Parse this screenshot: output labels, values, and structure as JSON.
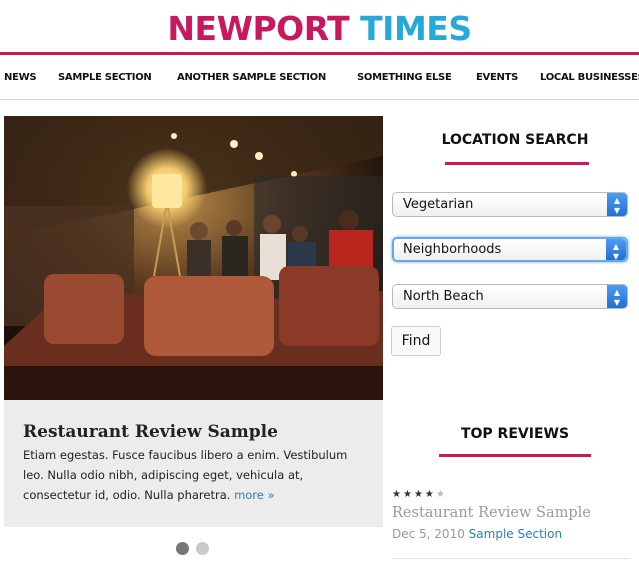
{
  "masthead": {
    "title_part1": "NEWPORT",
    "title_part2": "TIMES"
  },
  "nav": {
    "items": [
      {
        "label": "NEWS"
      },
      {
        "label": "SAMPLE SECTION"
      },
      {
        "label": "ANOTHER SAMPLE SECTION"
      },
      {
        "label": "SOMETHING ELSE"
      },
      {
        "label": "EVENTS"
      },
      {
        "label": "LOCAL BUSINESSES"
      }
    ]
  },
  "slider": {
    "title": "Restaurant Review Sample",
    "body": "Etiam egestas. Fusce faucibus libero a enim. Vestibulum leo. Nulla odio nibh, adipiscing eget, vehicula at, consectetur id, odio. Nulla pharetra.",
    "more": "more »",
    "slide_count": 2,
    "active_slide": 1
  },
  "location_search": {
    "heading": "LOCATION SEARCH",
    "cuisine": "Vegetarian",
    "area": "Neighborhoods",
    "neighborhood": "North Beach",
    "find_label": "Find"
  },
  "top_reviews": {
    "heading": "TOP REVIEWS",
    "items": [
      {
        "rating": 4,
        "max_rating": 5,
        "title": "Restaurant Review Sample",
        "date": "Dec 5, 2010",
        "section": "Sample Section"
      }
    ]
  },
  "colors": {
    "brand_magenta": "#c8185e",
    "brand_blue": "#26a8d8",
    "link": "#2b7fb8"
  }
}
